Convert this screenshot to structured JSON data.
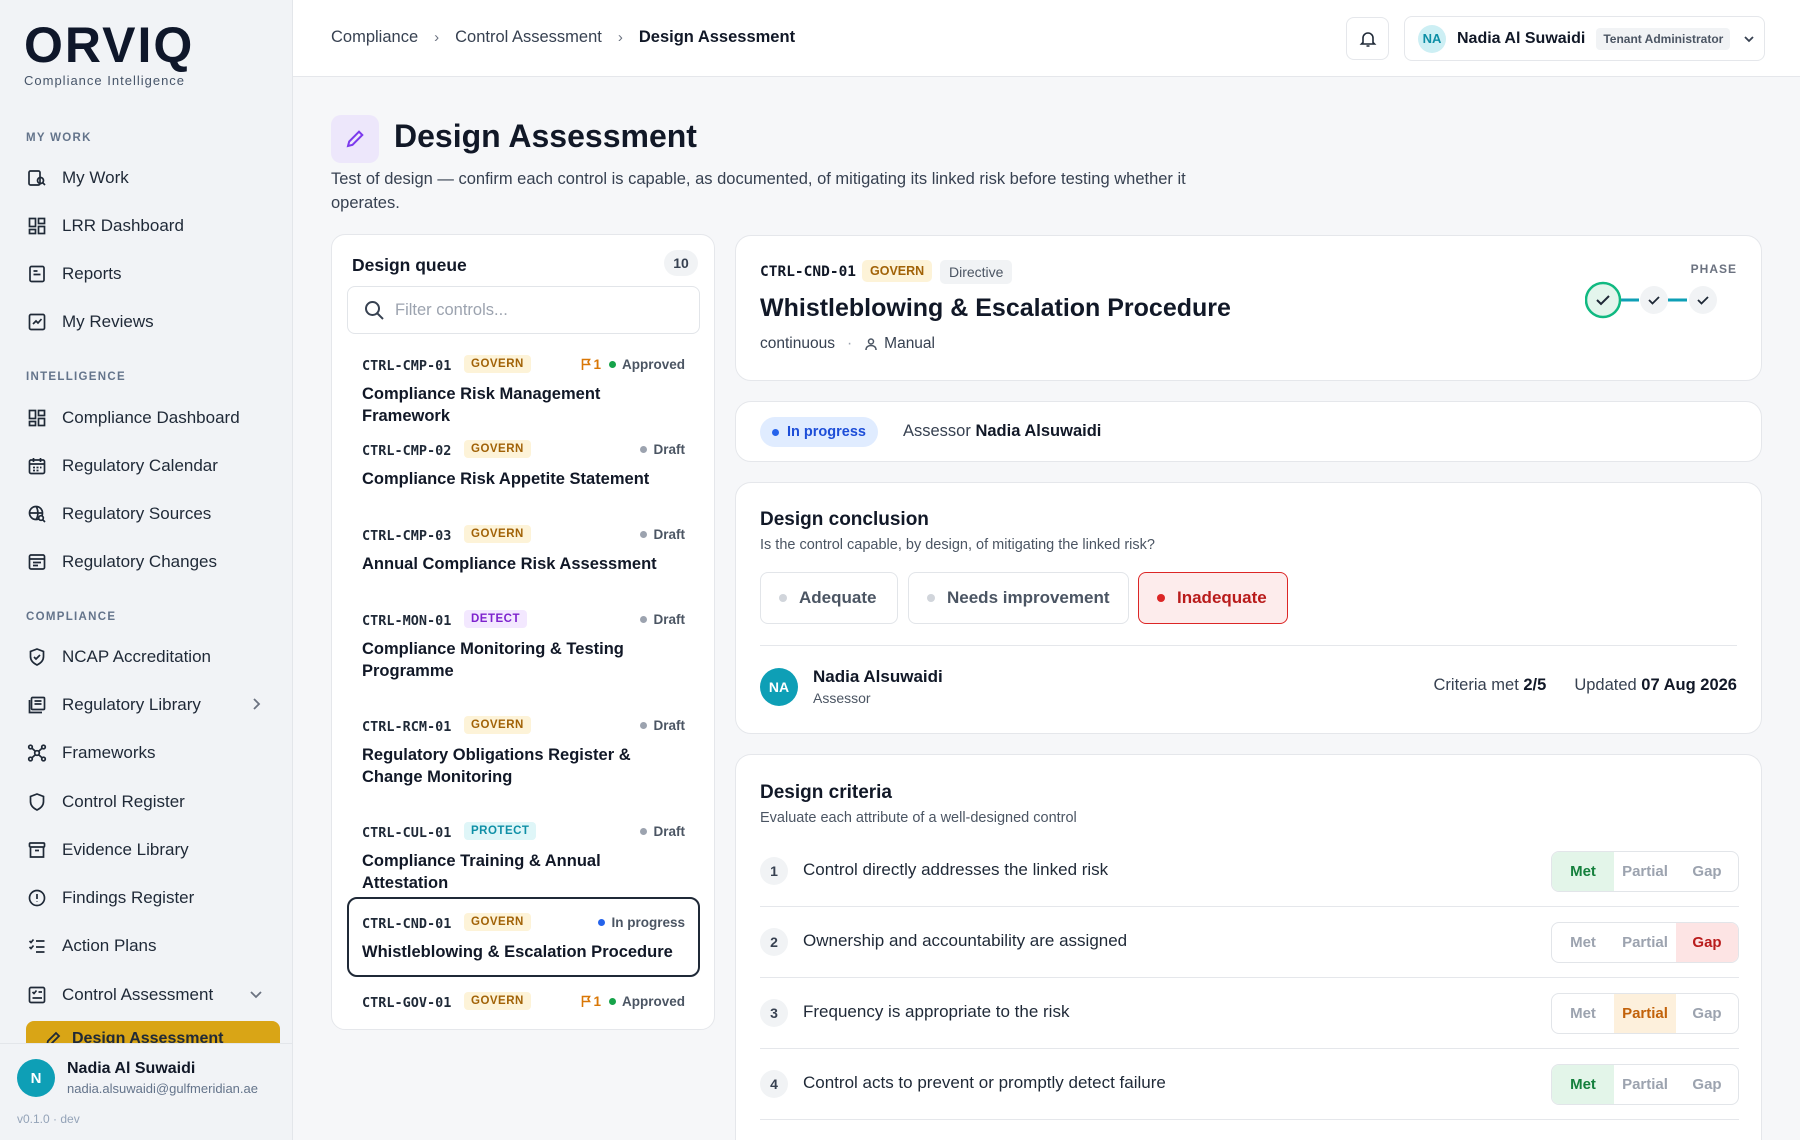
{
  "brand": {
    "name": "ORVIQ",
    "tagline": "Compliance Intelligence"
  },
  "sidebar": {
    "sections": [
      "MY WORK",
      "INTELLIGENCE",
      "COMPLIANCE"
    ],
    "items": [
      {
        "label": "My Work",
        "icon": "work-search-icon"
      },
      {
        "label": "LRR Dashboard",
        "icon": "dashboard-grid-icon"
      },
      {
        "label": "Reports",
        "icon": "report-icon"
      },
      {
        "label": "My Reviews",
        "icon": "review-icon"
      },
      {
        "label": "Compliance Dashboard",
        "icon": "dashboard-grid-icon"
      },
      {
        "label": "Regulatory Calendar",
        "icon": "calendar-icon"
      },
      {
        "label": "Regulatory Sources",
        "icon": "globe-search-icon"
      },
      {
        "label": "Regulatory Changes",
        "icon": "changes-icon"
      },
      {
        "label": "NCAP Accreditation",
        "icon": "shield-check-icon"
      },
      {
        "label": "Regulatory Library",
        "icon": "library-icon"
      },
      {
        "label": "Frameworks",
        "icon": "network-icon"
      },
      {
        "label": "Control Register",
        "icon": "shield-icon"
      },
      {
        "label": "Evidence Library",
        "icon": "archive-icon"
      },
      {
        "label": "Findings Register",
        "icon": "alert-circle-icon"
      },
      {
        "label": "Action Plans",
        "icon": "checklist-icon"
      },
      {
        "label": "Control Assessment",
        "icon": "assessment-icon"
      }
    ],
    "active_item": "Design Assessment",
    "user": {
      "initial": "N",
      "name": "Nadia Al Suwaidi",
      "email": "nadia.alsuwaidi@gulfmeridian.ae"
    },
    "version": "v0.1.0 · dev"
  },
  "header": {
    "breadcrumbs": [
      "Compliance",
      "Control Assessment",
      "Design Assessment"
    ],
    "user": {
      "initials": "NA",
      "name": "Nadia Al Suwaidi",
      "role": "Tenant Administrator"
    }
  },
  "page": {
    "title": "Design Assessment",
    "description": "Test of design — confirm each control is capable, as documented, of mitigating its linked risk before testing whether it operates."
  },
  "queue": {
    "title": "Design queue",
    "count": "10",
    "filter_placeholder": "Filter controls...",
    "items": [
      {
        "code": "CTRL-CMP-01",
        "tag": "GOVERN",
        "flag": "1",
        "status": "Approved",
        "name": "Compliance Risk Management Framework"
      },
      {
        "code": "CTRL-CMP-02",
        "tag": "GOVERN",
        "status": "Draft",
        "name": "Compliance Risk Appetite Statement"
      },
      {
        "code": "CTRL-CMP-03",
        "tag": "GOVERN",
        "status": "Draft",
        "name": "Annual Compliance Risk Assessment"
      },
      {
        "code": "CTRL-MON-01",
        "tag": "DETECT",
        "status": "Draft",
        "name": "Compliance Monitoring & Testing Programme"
      },
      {
        "code": "CTRL-RCM-01",
        "tag": "GOVERN",
        "status": "Draft",
        "name": "Regulatory Obligations Register & Change Monitoring"
      },
      {
        "code": "CTRL-CUL-01",
        "tag": "PROTECT",
        "status": "Draft",
        "name": "Compliance Training & Annual Attestation"
      },
      {
        "code": "CTRL-CND-01",
        "tag": "GOVERN",
        "status": "In progress",
        "name": "Whistleblowing & Escalation Procedure"
      },
      {
        "code": "CTRL-GOV-01",
        "tag": "GOVERN",
        "flag": "1",
        "status": "Approved",
        "name": ""
      }
    ]
  },
  "control": {
    "code": "CTRL-CND-01",
    "tag": "GOVERN",
    "type": "Directive",
    "title": "Whistleblowing & Escalation Procedure",
    "frequency": "continuous",
    "execution": "Manual",
    "phase_label": "PHASE"
  },
  "status": {
    "label": "In progress",
    "assessor_label": "Assessor",
    "assessor_name": "Nadia Alsuwaidi"
  },
  "conclusion": {
    "title": "Design conclusion",
    "subtitle": "Is the control capable, by design, of mitigating the linked risk?",
    "options": [
      "Adequate",
      "Needs improvement",
      "Inadequate"
    ],
    "selected": "Inadequate",
    "assessor_initials": "NA",
    "assessor_name": "Nadia Alsuwaidi",
    "assessor_role": "Assessor",
    "criteria_label": "Criteria met",
    "criteria_value": "2/5",
    "updated_label": "Updated",
    "updated_value": "07 Aug 2026"
  },
  "criteria": {
    "title": "Design criteria",
    "subtitle": "Evaluate each attribute of a well-designed control",
    "options": [
      "Met",
      "Partial",
      "Gap"
    ],
    "items": [
      {
        "num": "1",
        "text": "Control directly addresses the linked risk",
        "value": "Met"
      },
      {
        "num": "2",
        "text": "Ownership and accountability are assigned",
        "value": "Gap"
      },
      {
        "num": "3",
        "text": "Frequency is appropriate to the risk",
        "value": "Partial"
      },
      {
        "num": "4",
        "text": "Control acts to prevent or promptly detect failure",
        "value": "Met"
      }
    ]
  },
  "colors": {
    "accent": "#d9a516",
    "teal": "#0e9fb6",
    "in_progress": "#2563eb",
    "approved": "#16a34a",
    "draft": "#9ca3af",
    "gap": "#dc2626"
  }
}
